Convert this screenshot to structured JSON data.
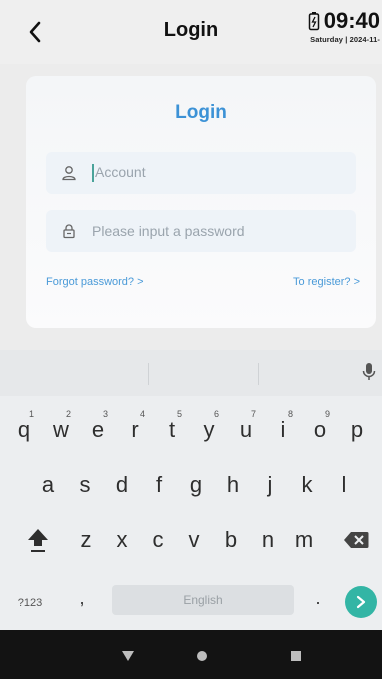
{
  "header": {
    "title": "Login",
    "time": "09:40",
    "date": "Saturday | 2024-11-"
  },
  "login": {
    "title": "Login",
    "account_placeholder": "Account",
    "password_placeholder": "Please input a password",
    "forgot_link": "Forgot password? >",
    "register_link": "To register? >"
  },
  "keyboard": {
    "row1": [
      {
        "key": "q",
        "hint": "1"
      },
      {
        "key": "w",
        "hint": "2"
      },
      {
        "key": "e",
        "hint": "3"
      },
      {
        "key": "r",
        "hint": "4"
      },
      {
        "key": "t",
        "hint": "5"
      },
      {
        "key": "y",
        "hint": "6"
      },
      {
        "key": "u",
        "hint": "7"
      },
      {
        "key": "i",
        "hint": "8"
      },
      {
        "key": "o",
        "hint": "9"
      },
      {
        "key": "p",
        "hint": ""
      }
    ],
    "row2": [
      "a",
      "s",
      "d",
      "f",
      "g",
      "h",
      "j",
      "k",
      "l"
    ],
    "row3": [
      "z",
      "x",
      "c",
      "v",
      "b",
      "n",
      "m"
    ],
    "symbols_label": "?123",
    "comma": ",",
    "space_label": "English",
    "period": "."
  },
  "colors": {
    "accent": "#3c92d6",
    "enter": "#33b5a5",
    "nav_bg": "#131313"
  },
  "icons": {
    "back": "chevron-left-icon",
    "battery": "battery-charging-icon",
    "user": "user-icon",
    "lock": "lock-icon",
    "mic": "mic-icon",
    "shift": "shift-icon",
    "backspace": "backspace-icon",
    "enter": "arrow-right-icon",
    "nav_back": "triangle-back-icon",
    "nav_home": "circle-home-icon",
    "nav_recents": "square-recents-icon"
  }
}
